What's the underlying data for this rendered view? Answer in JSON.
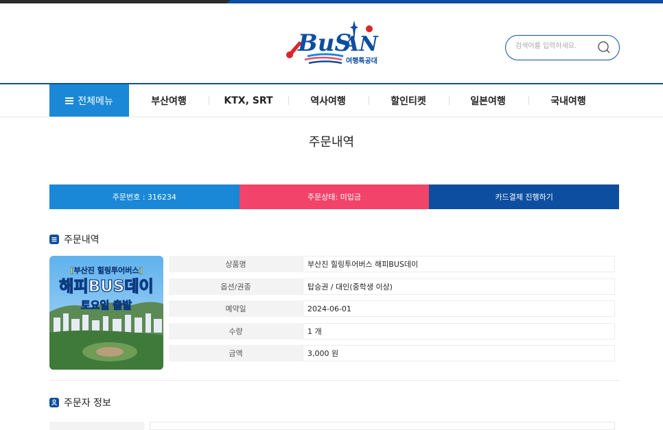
{
  "search": {
    "placeholder": "검색어를 입력하세요."
  },
  "logo": {
    "text": "BuSAN",
    "sub": "여행특공대"
  },
  "nav": {
    "all_menu": "전체메뉴",
    "items": [
      "부산여행",
      "KTX, SRT",
      "역사여행",
      "할인티켓",
      "일본여행",
      "국내여행"
    ]
  },
  "page": {
    "title": "주문내역"
  },
  "status": {
    "order_no": "주문번호 : 316234",
    "order_state": "주문상태: 미입금",
    "pay_button": "카드결제 진행하기"
  },
  "order_section": {
    "title": "주문내역"
  },
  "product_image": {
    "line1": "[부산진 힐링투어버스]",
    "line2": "해피BUS데이",
    "line3": "토요일 출발"
  },
  "details": [
    {
      "label": "상품명",
      "value": "부산진 힐링투어버스 해피BUS데이"
    },
    {
      "label": "옵션/권종",
      "value": "탑승권 / 대인(중학생 이상)"
    },
    {
      "label": "예약일",
      "value": "2024-06-01"
    },
    {
      "label": "수량",
      "value": "1 개"
    },
    {
      "label": "금액",
      "value": "3,000 원"
    }
  ],
  "orderer_section": {
    "title": "주문자 정보"
  },
  "colors": {
    "navy": "#0d4ea0",
    "blue": "#1a88d6",
    "pink": "#f2436a"
  }
}
